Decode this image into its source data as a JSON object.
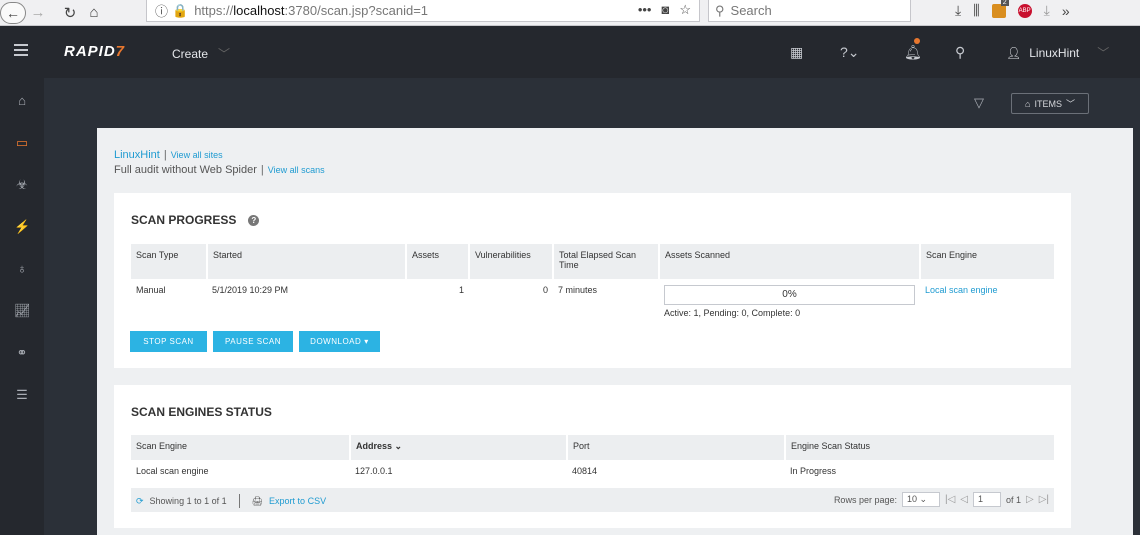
{
  "browser": {
    "url_prefix": "https://",
    "url_host": "localhost",
    "url_rest": ":3780/scan.jsp?scanid=1",
    "search_placeholder": "Search",
    "ext_badge_count": "2",
    "abp_label": "ABP"
  },
  "header": {
    "logo_main": "RAPID",
    "logo_accent": "7",
    "create_label": "Create",
    "username": "LinuxHint"
  },
  "toolbar": {
    "items_label": "ITEMS"
  },
  "breadcrumb": {
    "site_name": "LinuxHint",
    "view_all_sites": "View all sites",
    "scan_name": "Full audit without Web Spider",
    "view_all_scans": "View all scans"
  },
  "scan_progress": {
    "title": "SCAN PROGRESS",
    "columns": [
      "Scan Type",
      "Started",
      "Assets",
      "Vulnerabilities",
      "Total Elapsed Scan Time",
      "Assets Scanned",
      "Scan Engine"
    ],
    "row": {
      "scan_type": "Manual",
      "started": "5/1/2019 10:29 PM",
      "assets": "1",
      "vulnerabilities": "0",
      "elapsed": "7 minutes",
      "progress_percent": "0%",
      "progress_detail": "Active: 1, Pending: 0, Complete: 0",
      "engine": "Local scan engine"
    },
    "buttons": {
      "stop": "STOP SCAN",
      "pause": "PAUSE SCAN",
      "download": "DOWNLOAD"
    }
  },
  "engines_status": {
    "title": "SCAN ENGINES STATUS",
    "columns": [
      "Scan Engine",
      "Address",
      "Port",
      "Engine Scan Status"
    ],
    "rows": [
      {
        "engine": "Local scan engine",
        "address": "127.0.0.1",
        "port": "40814",
        "status": "In Progress"
      }
    ],
    "footer": {
      "showing": "Showing 1 to 1 of 1",
      "export": "Export to CSV",
      "rows_per_page_label": "Rows per page:",
      "rows_per_page": "10",
      "page": "1",
      "of_label": "of 1"
    }
  },
  "colors": {
    "accent": "#e8772e",
    "link": "#1f9bd1",
    "button": "#2cb3e3"
  }
}
